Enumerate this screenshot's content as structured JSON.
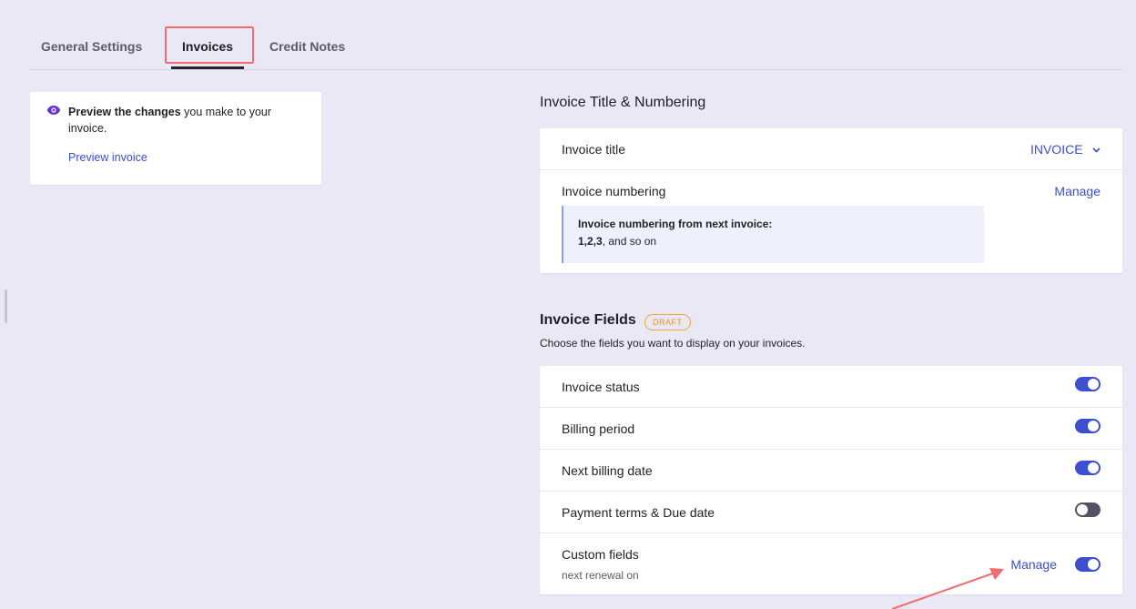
{
  "tabs": [
    {
      "label": "General Settings",
      "active": false
    },
    {
      "label": "Invoices",
      "active": true
    },
    {
      "label": "Credit Notes",
      "active": false
    }
  ],
  "preview": {
    "bold_text": "Preview the changes",
    "rest_text": " you make to your invoice.",
    "link": "Preview invoice",
    "icon": "eye-icon"
  },
  "title_numbering": {
    "heading": "Invoice Title & Numbering",
    "title_label": "Invoice title",
    "title_value": "INVOICE",
    "numbering_label": "Invoice numbering",
    "manage_label": "Manage",
    "info_line1": "Invoice numbering from next invoice:",
    "info_seq": "1,2,3",
    "info_rest": ", and so on"
  },
  "fields": {
    "heading": "Invoice Fields",
    "badge": "DRAFT",
    "subtitle": "Choose the fields you want to display on your invoices.",
    "items": [
      {
        "label": "Invoice status",
        "on": true
      },
      {
        "label": "Billing period",
        "on": true
      },
      {
        "label": "Next billing date",
        "on": true
      },
      {
        "label": "Payment terms & Due date",
        "on": false
      },
      {
        "label": "Custom fields",
        "sub": "next renewal on",
        "on": true,
        "manage": "Manage"
      }
    ]
  },
  "colors": {
    "accent": "#3b4fcf",
    "highlight": "#f06d6d",
    "badge": "#f2a73b",
    "background": "#ebe8f5"
  }
}
